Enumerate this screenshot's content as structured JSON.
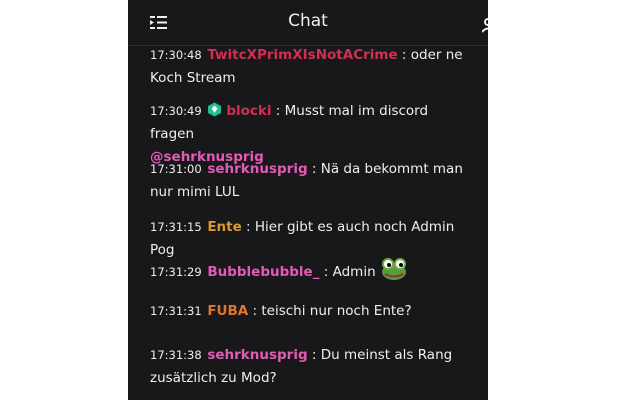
{
  "chat": {
    "title": "Chat",
    "messages": [
      {
        "time": "17:30:48",
        "user": "TwitcXPrimXIsNotACrime",
        "color": "#d03050",
        "text": " : oder ne Koch Stream"
      },
      {
        "time": "17:30:49",
        "user": "blocki",
        "color": "#d03050",
        "badge": "moderator-badge-icon",
        "text": " : Musst mal im discord fragen",
        "mention": "@sehrknusprig"
      },
      {
        "time": "17:31:00",
        "user": "sehrknusprig",
        "color": "#e25bb7",
        "text": " : Nä da bekommt man nur mimi LUL"
      },
      {
        "time": "17:31:15",
        "user": "Ente",
        "color": "#d99a2b",
        "text": " : Hier gibt es auch noch Admin Pog"
      },
      {
        "time": "17:31:29",
        "user": "Bubblebubble_",
        "color": "#e25bb7",
        "text": " : Admin",
        "emote": "frog-emote-icon"
      },
      {
        "time": "17:31:31",
        "user": "FUBA",
        "color": "#e0762b",
        "text": " : teischi nur noch Ente?"
      },
      {
        "time": "17:31:38",
        "user": "sehrknusprig",
        "color": "#e25bb7",
        "text": " : Du meinst als Rang zusätzlich zu Mod?"
      }
    ]
  }
}
